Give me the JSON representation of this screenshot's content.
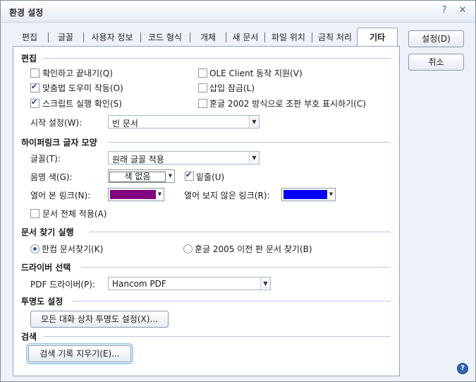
{
  "window": {
    "title": "환경 설정",
    "help_glyph": "?",
    "close_glyph": "✕"
  },
  "tabs": [
    "편집",
    "글꼴",
    "사용자 정보",
    "코드 형식",
    "개체",
    "새 문서",
    "파일 위치",
    "금칙 처리",
    "기타"
  ],
  "active_tab": "기타",
  "buttons": {
    "ok": "설정(D)",
    "cancel": "취소"
  },
  "edit": {
    "title": "편집",
    "confirm_exit": {
      "label": "확인하고 끝내기(Q)",
      "checked": false
    },
    "spellcheck": {
      "label": "맞춤법 도우미 작동(O)",
      "checked": true
    },
    "script_check": {
      "label": "스크립트 실행 확인(S)",
      "checked": true
    },
    "ole_client": {
      "label": "OLE Client 동작 지원(V)",
      "checked": false
    },
    "insert_lock": {
      "label": "삽입 잠금(L)",
      "checked": false
    },
    "hwp2002_protect": {
      "label": "훈글 2002 방식으로 조판 부호 표시하기(C)",
      "checked": false
    },
    "startup_label": "시작 설정(W):",
    "startup_value": "빈 문서"
  },
  "hyperlink": {
    "title": "하이퍼링크 글자 모양",
    "font_label": "글꼴(T):",
    "font_value": "원래 글꼴 적용",
    "shade_label": "음영 색(G):",
    "shade_value": "색 없음",
    "underline": {
      "label": "밑줄(U)",
      "checked": true
    },
    "visited_label": "열어 본 링크(N):",
    "visited_color": "#800080",
    "unvisited_label": "열어 보지 않은 링크(R):",
    "unvisited_color": "#0000ff",
    "apply_all": {
      "label": "문서 전체 적용(A)",
      "checked": false
    }
  },
  "search": {
    "title": "문서 찾기 실행",
    "option_hancom": {
      "label": "한컴 문서찾기(K)",
      "selected": true
    },
    "option_legacy": {
      "label": "훈글 2005 이전 판 문서 찾기(B)",
      "selected": false
    }
  },
  "driver": {
    "title": "드라이버 선택",
    "pdf_label": "PDF 드라이버(P):",
    "pdf_value": "Hancom PDF"
  },
  "transparency": {
    "title": "투명도 설정",
    "button": "모든 대화 상자 투명도 설정(X)..."
  },
  "history": {
    "title": "검색",
    "button": "검색 기록 지우기(E)..."
  }
}
